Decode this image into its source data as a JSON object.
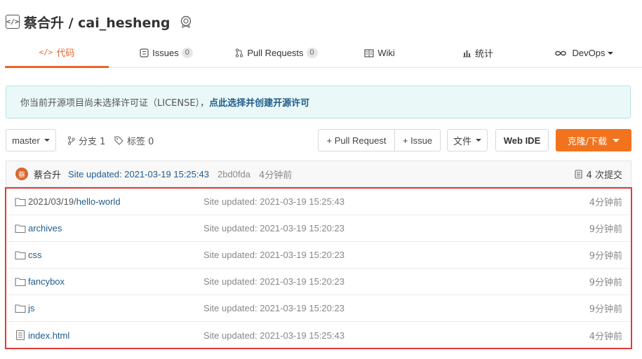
{
  "repo": {
    "title": "蔡合升 / cai_hesheng",
    "code_icon": "code-icon",
    "badge_icon": "award-badge-icon"
  },
  "tabs": [
    {
      "label": "代码",
      "icon": "code-icon",
      "active": true
    },
    {
      "label": "Issues",
      "count": "0",
      "icon": "issues-icon"
    },
    {
      "label": "Pull Requests",
      "count": "0",
      "icon": "pull-request-icon"
    },
    {
      "label": "Wiki",
      "icon": "wiki-icon"
    },
    {
      "label": "统计",
      "icon": "stats-icon"
    },
    {
      "label": "DevOps",
      "icon": "devops-icon"
    }
  ],
  "notice": {
    "text": "你当前开源项目尚未选择许可证（LICENSE），",
    "link": "点此选择并创建开源许可"
  },
  "toolbar": {
    "branch": "master",
    "branches": "分支 1",
    "tags": "标签 0",
    "pull_request": "+ Pull Request",
    "issue": "+ Issue",
    "files": "文件",
    "web_ide": "Web IDE",
    "clone": "克隆/下载"
  },
  "commit": {
    "avatar_text": "蔡",
    "author": "蔡合升",
    "message": "Site updated: 2021-03-19 15:25:43",
    "hash": "2bd0fda",
    "time": "4分钟前",
    "count": "4 次提交"
  },
  "files": [
    {
      "name_prefix": "2021/03/19/",
      "name": "hello-world",
      "message": "Site updated: 2021-03-19 15:25:43",
      "time": "4分钟前",
      "type": "folder"
    },
    {
      "name_prefix": "",
      "name": "archives",
      "message": "Site updated: 2021-03-19 15:20:23",
      "time": "9分钟前",
      "type": "folder"
    },
    {
      "name_prefix": "",
      "name": "css",
      "message": "Site updated: 2021-03-19 15:20:23",
      "time": "9分钟前",
      "type": "folder"
    },
    {
      "name_prefix": "",
      "name": "fancybox",
      "message": "Site updated: 2021-03-19 15:20:23",
      "time": "9分钟前",
      "type": "folder"
    },
    {
      "name_prefix": "",
      "name": "js",
      "message": "Site updated: 2021-03-19 15:20:23",
      "time": "9分钟前",
      "type": "folder"
    },
    {
      "name_prefix": "",
      "name": "index.html",
      "message": "Site updated: 2021-03-19 15:25:43",
      "time": "4分钟前",
      "type": "file"
    }
  ],
  "colors": {
    "accent": "#e8642a",
    "link": "#1f5d8c",
    "highlight_border": "#e03b3b"
  }
}
